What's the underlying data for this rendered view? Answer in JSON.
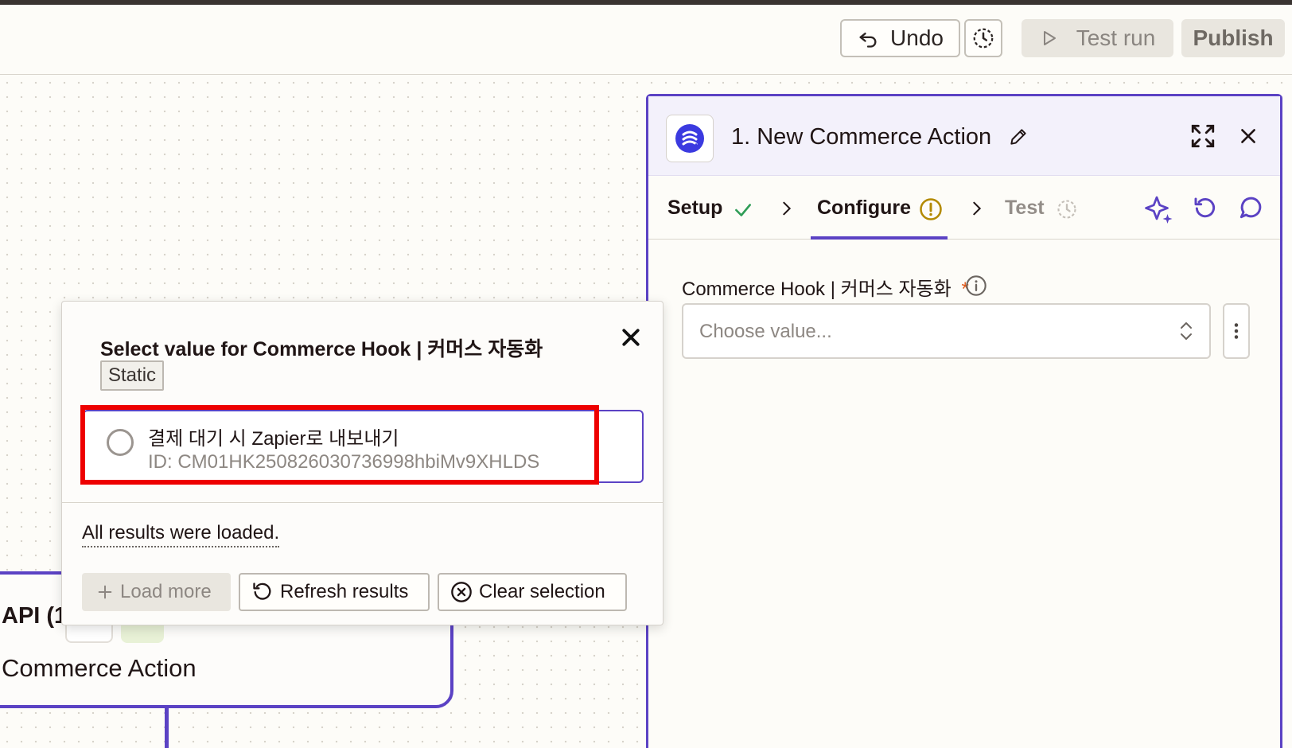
{
  "toolbar": {
    "undo_label": "Undo",
    "test_run_label": "Test run",
    "publish_label": "Publish"
  },
  "background_node": {
    "api_label": "API (1",
    "title": "Commerce Action"
  },
  "panel": {
    "title": "1. New Commerce Action",
    "steps": [
      {
        "label": "Setup",
        "status": "complete"
      },
      {
        "label": "Configure",
        "status": "warning"
      },
      {
        "label": "Test",
        "status": "pending"
      }
    ],
    "field_label": "Commerce Hook | 커머스 자동화",
    "required_mark": "*",
    "select_placeholder": "Choose value..."
  },
  "popup": {
    "title": "Select value for Commerce Hook | 커머스 자동화",
    "badge": "Static",
    "option": {
      "title": "결제 대기 시 Zapier로 내보내기",
      "id_line": "ID: CM01HK250826030736998hbiMv9XHLDS"
    },
    "loaded_message": "All results were loaded.",
    "load_more_label": "Load more",
    "refresh_label": "Refresh results",
    "clear_label": "Clear selection"
  },
  "colors": {
    "accent": "#5b42c4",
    "highlight": "#ee0000",
    "success": "#2f9d57",
    "warning": "#b38a00",
    "required": "#e05a1b"
  }
}
